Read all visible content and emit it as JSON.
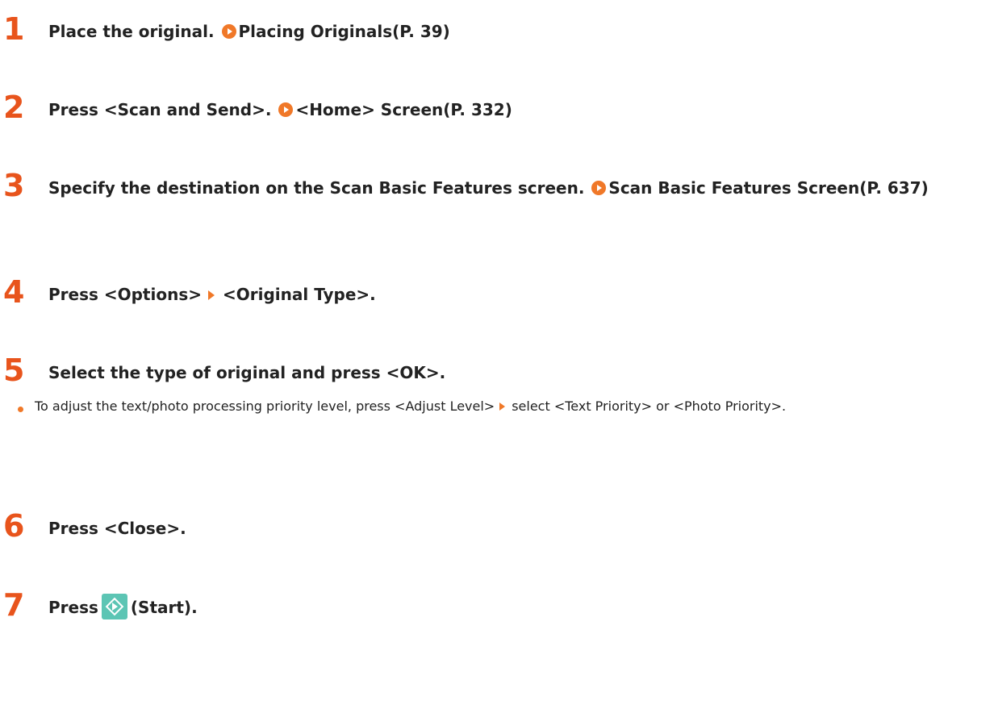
{
  "steps": [
    {
      "number": "1",
      "text": "Place the original.",
      "link": "Placing Originals(P. 39)"
    },
    {
      "number": "2",
      "text": "Press <Scan and Send>.",
      "link": "<Home> Screen(P. 332)"
    },
    {
      "number": "3",
      "text": "Specify the destination on the Scan Basic Features screen.",
      "link": "Scan Basic Features Screen(P. 637)"
    },
    {
      "number": "4",
      "text_before": "Press <Options>",
      "text_after": "<Original Type>."
    },
    {
      "number": "5",
      "text": "Select the type of original and press <OK>.",
      "bullet": {
        "before": "To adjust the text/photo processing priority level, press <Adjust Level>",
        "after": "select <Text Priority> or <Photo Priority>."
      }
    },
    {
      "number": "6",
      "text": "Press <Close>."
    },
    {
      "number": "7",
      "text_before": "Press",
      "text_after": "(Start)."
    }
  ],
  "icons": {
    "link": "link-arrow-icon",
    "separator": "next-arrow-icon",
    "start": "start-key-icon"
  },
  "colors": {
    "step_number": "#e8541c",
    "accent": "#f07828",
    "start_key": "#5cc5b4"
  }
}
